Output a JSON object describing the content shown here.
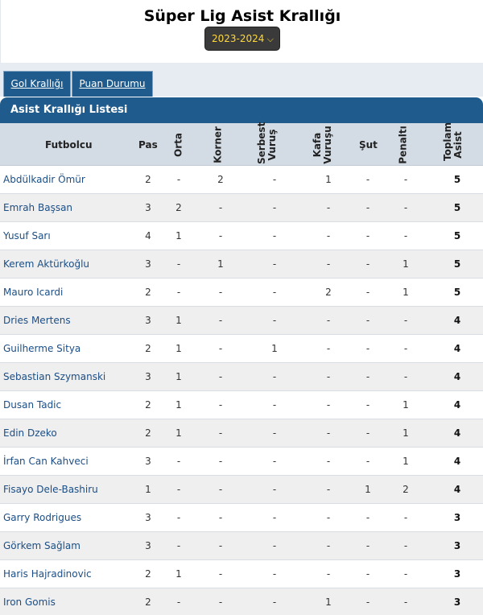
{
  "page": {
    "title": "Süper Lig Asist Krallığı",
    "season": "2023-2024"
  },
  "tabs": [
    "Gol Krallığı",
    "Puan Durumu"
  ],
  "list_title": "Asist Krallığı Listesi",
  "columns": {
    "player": "Futbolcu",
    "pass": "Pas",
    "cross": "Orta",
    "corner": "Korner",
    "free_kick": "Serbest Vuruş",
    "header": "Kafa Vuruşu",
    "shot": "Şut",
    "penalty": "Penaltı",
    "total": "Toplam Asist"
  },
  "rows": [
    {
      "name": "Abdülkadir Ömür",
      "pass": "2",
      "cross": "-",
      "corner": "2",
      "free_kick": "-",
      "header": "1",
      "shot": "-",
      "penalty": "-",
      "total": "5"
    },
    {
      "name": "Emrah Başsan",
      "pass": "3",
      "cross": "2",
      "corner": "-",
      "free_kick": "-",
      "header": "-",
      "shot": "-",
      "penalty": "-",
      "total": "5"
    },
    {
      "name": "Yusuf Sarı",
      "pass": "4",
      "cross": "1",
      "corner": "-",
      "free_kick": "-",
      "header": "-",
      "shot": "-",
      "penalty": "-",
      "total": "5"
    },
    {
      "name": "Kerem Aktürkoğlu",
      "pass": "3",
      "cross": "-",
      "corner": "1",
      "free_kick": "-",
      "header": "-",
      "shot": "-",
      "penalty": "1",
      "total": "5"
    },
    {
      "name": "Mauro Icardi",
      "pass": "2",
      "cross": "-",
      "corner": "-",
      "free_kick": "-",
      "header": "2",
      "shot": "-",
      "penalty": "1",
      "total": "5"
    },
    {
      "name": "Dries Mertens",
      "pass": "3",
      "cross": "1",
      "corner": "-",
      "free_kick": "-",
      "header": "-",
      "shot": "-",
      "penalty": "-",
      "total": "4"
    },
    {
      "name": "Guilherme Sitya",
      "pass": "2",
      "cross": "1",
      "corner": "-",
      "free_kick": "1",
      "header": "-",
      "shot": "-",
      "penalty": "-",
      "total": "4"
    },
    {
      "name": "Sebastian Szymanski",
      "pass": "3",
      "cross": "1",
      "corner": "-",
      "free_kick": "-",
      "header": "-",
      "shot": "-",
      "penalty": "-",
      "total": "4"
    },
    {
      "name": "Dusan Tadic",
      "pass": "2",
      "cross": "1",
      "corner": "-",
      "free_kick": "-",
      "header": "-",
      "shot": "-",
      "penalty": "1",
      "total": "4"
    },
    {
      "name": "Edin Dzeko",
      "pass": "2",
      "cross": "1",
      "corner": "-",
      "free_kick": "-",
      "header": "-",
      "shot": "-",
      "penalty": "1",
      "total": "4"
    },
    {
      "name": "İrfan Can Kahveci",
      "pass": "3",
      "cross": "-",
      "corner": "-",
      "free_kick": "-",
      "header": "-",
      "shot": "-",
      "penalty": "1",
      "total": "4"
    },
    {
      "name": "Fisayo Dele-Bashiru",
      "pass": "1",
      "cross": "-",
      "corner": "-",
      "free_kick": "-",
      "header": "-",
      "shot": "1",
      "penalty": "2",
      "total": "4"
    },
    {
      "name": "Garry Rodrigues",
      "pass": "3",
      "cross": "-",
      "corner": "-",
      "free_kick": "-",
      "header": "-",
      "shot": "-",
      "penalty": "-",
      "total": "3"
    },
    {
      "name": "Görkem Sağlam",
      "pass": "3",
      "cross": "-",
      "corner": "-",
      "free_kick": "-",
      "header": "-",
      "shot": "-",
      "penalty": "-",
      "total": "3"
    },
    {
      "name": "Haris Hajradinovic",
      "pass": "2",
      "cross": "1",
      "corner": "-",
      "free_kick": "-",
      "header": "-",
      "shot": "-",
      "penalty": "-",
      "total": "3"
    },
    {
      "name": "Iron Gomis",
      "pass": "2",
      "cross": "-",
      "corner": "-",
      "free_kick": "-",
      "header": "1",
      "shot": "-",
      "penalty": "-",
      "total": "3"
    }
  ],
  "colors": {
    "header_blue": "#1f5c8d",
    "season_text": "#ffd83a",
    "player_link": "#1b4e86",
    "row_alt": "#efefef"
  }
}
